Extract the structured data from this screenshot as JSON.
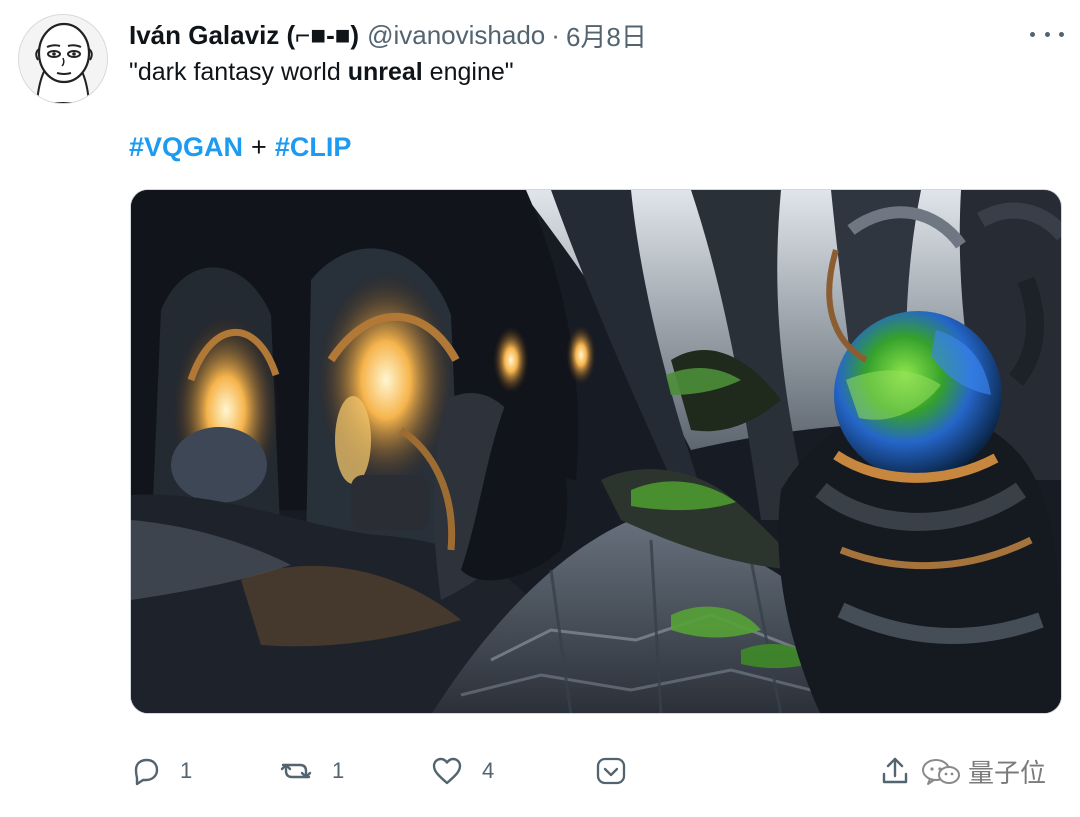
{
  "author": {
    "name": "Iván Galaviz (⌐■-■)",
    "handle": "@ivanovishado",
    "separator": "·",
    "date": "6月8日"
  },
  "tweet": {
    "text_before": "\"dark fantasy world ",
    "text_bold": "unreal",
    "text_after": " engine\"",
    "hashtag1": "#VQGAN",
    "plus": "+",
    "hashtag2": "#CLIP"
  },
  "actions": {
    "reply_count": "1",
    "retweet_count": "1",
    "like_count": "4"
  },
  "watermark": "量子位",
  "icons": [
    "more-icon",
    "reply-icon",
    "retweet-icon",
    "like-icon",
    "dropdown-icon",
    "share-icon",
    "wechat-icon"
  ],
  "colors": {
    "hashtag": "#1d9bf0",
    "secondary_text": "#536471"
  }
}
